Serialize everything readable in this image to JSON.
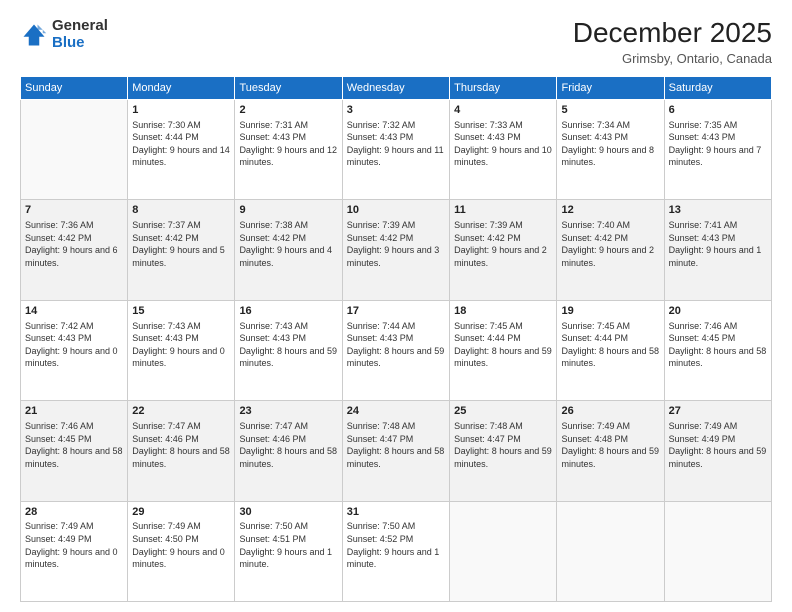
{
  "header": {
    "logo_general": "General",
    "logo_blue": "Blue",
    "month": "December 2025",
    "location": "Grimsby, Ontario, Canada"
  },
  "days_of_week": [
    "Sunday",
    "Monday",
    "Tuesday",
    "Wednesday",
    "Thursday",
    "Friday",
    "Saturday"
  ],
  "weeks": [
    [
      {
        "day": "",
        "info": ""
      },
      {
        "day": "1",
        "info": "Sunrise: 7:30 AM\nSunset: 4:44 PM\nDaylight: 9 hours\nand 14 minutes."
      },
      {
        "day": "2",
        "info": "Sunrise: 7:31 AM\nSunset: 4:43 PM\nDaylight: 9 hours\nand 12 minutes."
      },
      {
        "day": "3",
        "info": "Sunrise: 7:32 AM\nSunset: 4:43 PM\nDaylight: 9 hours\nand 11 minutes."
      },
      {
        "day": "4",
        "info": "Sunrise: 7:33 AM\nSunset: 4:43 PM\nDaylight: 9 hours\nand 10 minutes."
      },
      {
        "day": "5",
        "info": "Sunrise: 7:34 AM\nSunset: 4:43 PM\nDaylight: 9 hours\nand 8 minutes."
      },
      {
        "day": "6",
        "info": "Sunrise: 7:35 AM\nSunset: 4:43 PM\nDaylight: 9 hours\nand 7 minutes."
      }
    ],
    [
      {
        "day": "7",
        "info": "Sunrise: 7:36 AM\nSunset: 4:42 PM\nDaylight: 9 hours\nand 6 minutes."
      },
      {
        "day": "8",
        "info": "Sunrise: 7:37 AM\nSunset: 4:42 PM\nDaylight: 9 hours\nand 5 minutes."
      },
      {
        "day": "9",
        "info": "Sunrise: 7:38 AM\nSunset: 4:42 PM\nDaylight: 9 hours\nand 4 minutes."
      },
      {
        "day": "10",
        "info": "Sunrise: 7:39 AM\nSunset: 4:42 PM\nDaylight: 9 hours\nand 3 minutes."
      },
      {
        "day": "11",
        "info": "Sunrise: 7:39 AM\nSunset: 4:42 PM\nDaylight: 9 hours\nand 2 minutes."
      },
      {
        "day": "12",
        "info": "Sunrise: 7:40 AM\nSunset: 4:42 PM\nDaylight: 9 hours\nand 2 minutes."
      },
      {
        "day": "13",
        "info": "Sunrise: 7:41 AM\nSunset: 4:43 PM\nDaylight: 9 hours\nand 1 minute."
      }
    ],
    [
      {
        "day": "14",
        "info": "Sunrise: 7:42 AM\nSunset: 4:43 PM\nDaylight: 9 hours\nand 0 minutes."
      },
      {
        "day": "15",
        "info": "Sunrise: 7:43 AM\nSunset: 4:43 PM\nDaylight: 9 hours\nand 0 minutes."
      },
      {
        "day": "16",
        "info": "Sunrise: 7:43 AM\nSunset: 4:43 PM\nDaylight: 8 hours\nand 59 minutes."
      },
      {
        "day": "17",
        "info": "Sunrise: 7:44 AM\nSunset: 4:43 PM\nDaylight: 8 hours\nand 59 minutes."
      },
      {
        "day": "18",
        "info": "Sunrise: 7:45 AM\nSunset: 4:44 PM\nDaylight: 8 hours\nand 59 minutes."
      },
      {
        "day": "19",
        "info": "Sunrise: 7:45 AM\nSunset: 4:44 PM\nDaylight: 8 hours\nand 58 minutes."
      },
      {
        "day": "20",
        "info": "Sunrise: 7:46 AM\nSunset: 4:45 PM\nDaylight: 8 hours\nand 58 minutes."
      }
    ],
    [
      {
        "day": "21",
        "info": "Sunrise: 7:46 AM\nSunset: 4:45 PM\nDaylight: 8 hours\nand 58 minutes."
      },
      {
        "day": "22",
        "info": "Sunrise: 7:47 AM\nSunset: 4:46 PM\nDaylight: 8 hours\nand 58 minutes."
      },
      {
        "day": "23",
        "info": "Sunrise: 7:47 AM\nSunset: 4:46 PM\nDaylight: 8 hours\nand 58 minutes."
      },
      {
        "day": "24",
        "info": "Sunrise: 7:48 AM\nSunset: 4:47 PM\nDaylight: 8 hours\nand 58 minutes."
      },
      {
        "day": "25",
        "info": "Sunrise: 7:48 AM\nSunset: 4:47 PM\nDaylight: 8 hours\nand 59 minutes."
      },
      {
        "day": "26",
        "info": "Sunrise: 7:49 AM\nSunset: 4:48 PM\nDaylight: 8 hours\nand 59 minutes."
      },
      {
        "day": "27",
        "info": "Sunrise: 7:49 AM\nSunset: 4:49 PM\nDaylight: 8 hours\nand 59 minutes."
      }
    ],
    [
      {
        "day": "28",
        "info": "Sunrise: 7:49 AM\nSunset: 4:49 PM\nDaylight: 9 hours\nand 0 minutes."
      },
      {
        "day": "29",
        "info": "Sunrise: 7:49 AM\nSunset: 4:50 PM\nDaylight: 9 hours\nand 0 minutes."
      },
      {
        "day": "30",
        "info": "Sunrise: 7:50 AM\nSunset: 4:51 PM\nDaylight: 9 hours\nand 1 minute."
      },
      {
        "day": "31",
        "info": "Sunrise: 7:50 AM\nSunset: 4:52 PM\nDaylight: 9 hours\nand 1 minute."
      },
      {
        "day": "",
        "info": ""
      },
      {
        "day": "",
        "info": ""
      },
      {
        "day": "",
        "info": ""
      }
    ]
  ]
}
